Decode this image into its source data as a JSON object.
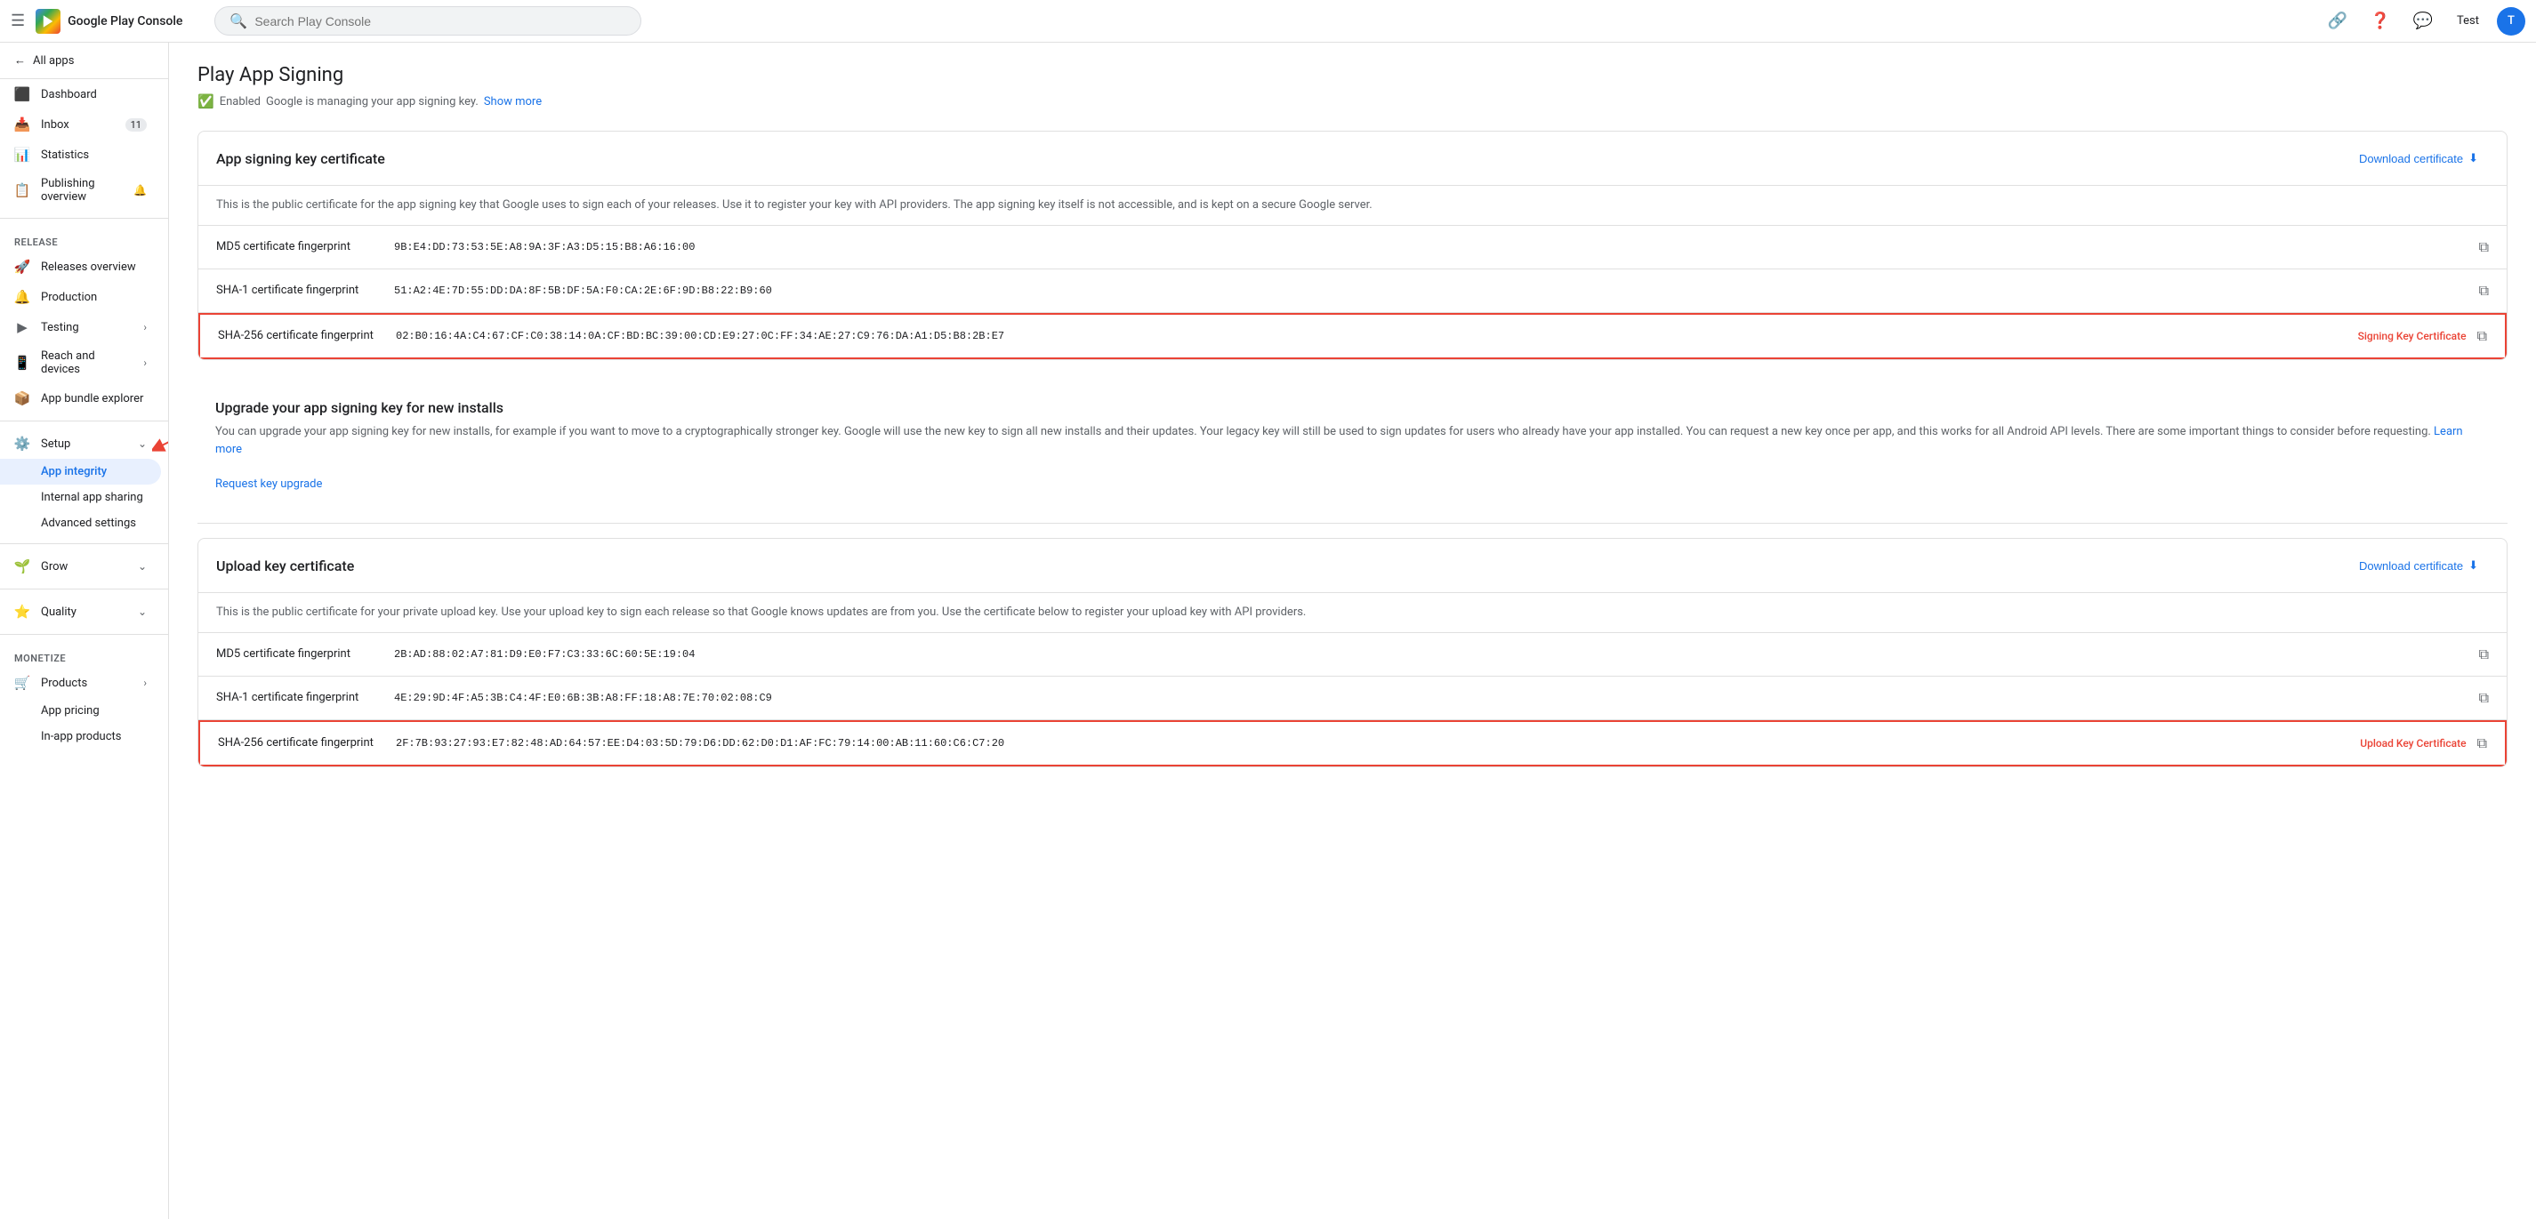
{
  "topbar": {
    "logo_text": "Google Play Console",
    "search_placeholder": "Search Play Console",
    "test_label": "Test",
    "link_icon": "🔗",
    "help_icon": "?",
    "feedback_icon": "💬"
  },
  "sidebar": {
    "all_apps_label": "All apps",
    "nav_items": [
      {
        "id": "dashboard",
        "label": "Dashboard",
        "icon": "📊",
        "badge": ""
      },
      {
        "id": "inbox",
        "label": "Inbox",
        "icon": "📥",
        "badge": "11"
      },
      {
        "id": "statistics",
        "label": "Statistics",
        "icon": "📈",
        "badge": ""
      },
      {
        "id": "publishing-overview",
        "label": "Publishing overview",
        "icon": "📋",
        "badge": ""
      }
    ],
    "release_section": "Release",
    "release_items": [
      {
        "id": "releases-overview",
        "label": "Releases overview",
        "icon": "🚀"
      },
      {
        "id": "production",
        "label": "Production",
        "icon": "🔔"
      },
      {
        "id": "testing",
        "label": "Testing",
        "icon": "🧪"
      },
      {
        "id": "reach-and-devices",
        "label": "Reach and devices",
        "icon": "📱"
      },
      {
        "id": "app-bundle-explorer",
        "label": "App bundle explorer",
        "icon": "📦"
      }
    ],
    "setup_section": "Setup",
    "setup_expanded": true,
    "setup_items": [
      {
        "id": "setup",
        "label": "Setup",
        "icon": "⚙️"
      }
    ],
    "setup_sub_items": [
      {
        "id": "app-integrity",
        "label": "App integrity",
        "active": true
      },
      {
        "id": "internal-app-sharing",
        "label": "Internal app sharing"
      },
      {
        "id": "advanced-settings",
        "label": "Advanced settings"
      }
    ],
    "grow_section": "Grow",
    "quality_section": "Quality",
    "monetize_section": "Monetize",
    "monetize_items": [
      {
        "id": "products",
        "label": "Products",
        "icon": "🛒"
      },
      {
        "id": "app-pricing",
        "label": "App pricing"
      },
      {
        "id": "in-app-products",
        "label": "In-app products"
      }
    ]
  },
  "main": {
    "page_title": "Play App Signing",
    "enabled_label": "Enabled",
    "managing_text": "Google is managing your app signing key.",
    "show_more_link": "Show more",
    "app_signing_cert": {
      "title": "App signing key certificate",
      "download_label": "Download certificate",
      "description": "This is the public certificate for the app signing key that Google uses to sign each of your releases. Use it to register your key with API providers. The app signing key itself is not accessible, and is kept on a secure Google server.",
      "rows": [
        {
          "label": "MD5 certificate fingerprint",
          "value": "9B:E4:DD:73:53:5E:A8:9A:3F:A3:D5:15:B8:A6:16:00",
          "highlighted": false,
          "badge": ""
        },
        {
          "label": "SHA-1 certificate fingerprint",
          "value": "51:A2:4E:7D:55:DD:DA:8F:5B:DF:5A:F0:CA:2E:6F:9D:B8:22:B9:60",
          "highlighted": false,
          "badge": ""
        },
        {
          "label": "SHA-256 certificate fingerprint",
          "value": "02:B0:16:4A:C4:67:CF:C0:38:14:0A:CF:BD:BC:39:00:CD:E9:27:0C:FF:34:AE:27:C9:76:DA:A1:D5:B8:2B:E7",
          "highlighted": true,
          "badge": "Signing Key Certificate"
        }
      ]
    },
    "upgrade_section": {
      "title": "Upgrade your app signing key for new installs",
      "description": "You can upgrade your app signing key for new installs, for example if you want to move to a cryptographically stronger key. Google will use the new key to sign all new installs and their updates. Your legacy key will still be used to sign updates for users who already have your app installed. You can request a new key once per app, and this works for all Android API levels. There are some important things to consider before requesting.",
      "learn_more_link": "Learn more",
      "request_link": "Request key upgrade"
    },
    "upload_key_cert": {
      "title": "Upload key certificate",
      "download_label": "Download certificate",
      "description": "This is the public certificate for your private upload key. Use your upload key to sign each release so that Google knows updates are from you. Use the certificate below to register your upload key with API providers.",
      "rows": [
        {
          "label": "MD5 certificate fingerprint",
          "value": "2B:AD:88:02:A7:81:D9:E0:F7:C3:33:6C:60:5E:19:04",
          "highlighted": false,
          "badge": ""
        },
        {
          "label": "SHA-1 certificate fingerprint",
          "value": "4E:29:9D:4F:A5:3B:C4:4F:E0:6B:3B:A8:FF:18:A8:7E:70:02:08:C9",
          "highlighted": false,
          "badge": ""
        },
        {
          "label": "SHA-256 certificate fingerprint",
          "value": "2F:7B:93:27:93:E7:82:48:AD:64:57:EE:D4:03:5D:79:D6:DD:62:D0:D1:AF:FC:79:14:00:AB:11:60:C6:C7:20",
          "highlighted": true,
          "badge": "Upload Key Certificate"
        }
      ]
    }
  }
}
